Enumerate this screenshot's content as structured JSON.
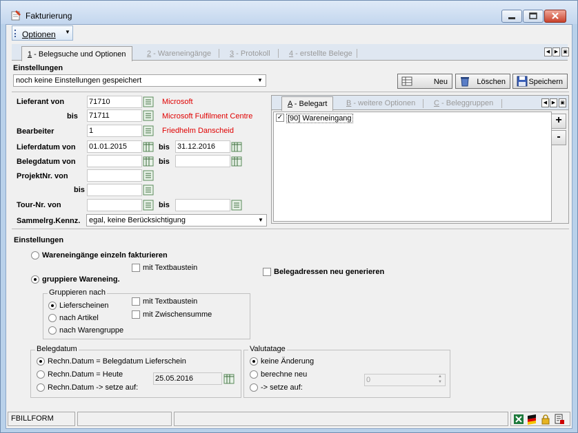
{
  "window": {
    "title": "Fakturierung"
  },
  "menu": {
    "optionen": "Optionen"
  },
  "tabs": [
    {
      "num": "1",
      "label": " - Belegsuche und Optionen"
    },
    {
      "num": "2",
      "label": " - Wareneingänge"
    },
    {
      "num": "3",
      "label": " - Protokoll"
    },
    {
      "num": "4",
      "label": " - erstellte Belege"
    }
  ],
  "settings": {
    "heading": "Einstellungen",
    "combo_value": "noch keine Einstellungen gespeichert",
    "btn_new": "Neu",
    "btn_delete": "Löschen",
    "btn_save": "Speichern"
  },
  "filters": {
    "lieferant_von_label": "Lieferant von",
    "lieferant_von_value": "71710",
    "lieferant_von_name": "Microsoft",
    "bis_label": "bis",
    "lieferant_bis_value": "71711",
    "lieferant_bis_name": "Microsoft Fulfilment Centre",
    "bearbeiter_label": "Bearbeiter",
    "bearbeiter_value": "1",
    "bearbeiter_name": "Friedhelm Danscheid",
    "lieferdatum_label": "Lieferdatum von",
    "lieferdatum_von": "01.01.2015",
    "lieferdatum_bis": "31.12.2016",
    "belegdatum_label": "Belegdatum von",
    "projekt_label": "ProjektNr. von",
    "tour_label": "Tour-Nr. von",
    "sammel_label": "Sammelrg.Kennz.",
    "sammel_value": "egal, keine Berücksichtigung"
  },
  "right_tabs": [
    {
      "num": "A",
      "label": " - Belegart"
    },
    {
      "num": "B",
      "label": " - weitere Optionen"
    },
    {
      "num": "C",
      "label": " - Beleggruppen"
    }
  ],
  "belegart_items": [
    {
      "label": "[90] Wareneingang",
      "checked": true
    }
  ],
  "side_buttons": {
    "add": "+",
    "remove": "-"
  },
  "options": {
    "heading": "Einstellungen",
    "einzeln": "Wareneingänge einzeln fakturieren",
    "mit_textbaustein_1": "mit Textbaustein",
    "gruppiere": "gruppiere Wareneing.",
    "belegadressen": "Belegadressen neu generieren",
    "gruppieren_nach": "Gruppieren nach",
    "lieferscheinen": "Lieferscheinen",
    "nach_artikel": "nach Artikel",
    "nach_warengruppe": "nach Warengruppe",
    "mit_textbaustein_2": "mit Textbaustein",
    "mit_zwischensumme": "mit Zwischensumme"
  },
  "belegdatum_group": {
    "legend": "Belegdatum",
    "opt1": "Rechn.Datum = Belegdatum Lieferschein",
    "opt2": "Rechn.Datum = Heute",
    "opt3": "Rechn.Datum -> setze auf:",
    "date_value": "25.05.2016"
  },
  "valuta_group": {
    "legend": "Valutatage",
    "opt1": "keine Änderung",
    "opt2": "berechne neu",
    "opt3": "-> setze auf:",
    "value": "0"
  },
  "status": {
    "form": "FBILLFORM"
  }
}
